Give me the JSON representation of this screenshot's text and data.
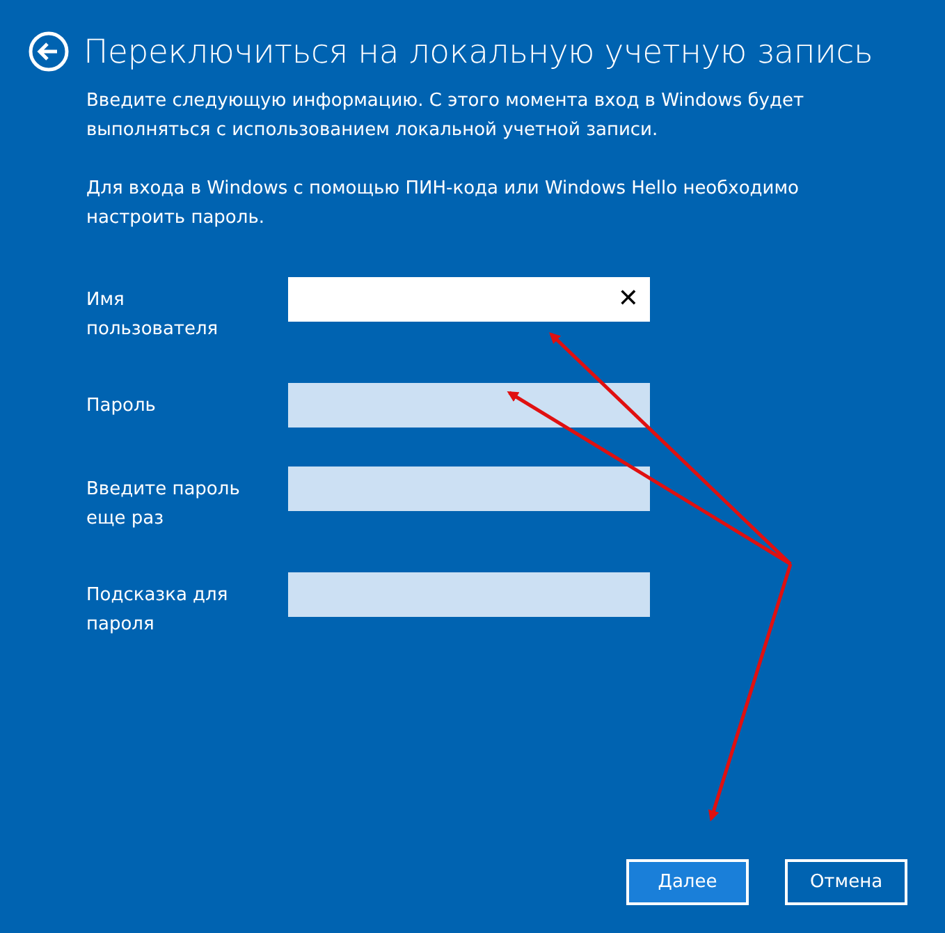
{
  "title": "Переключиться на локальную учетную запись",
  "paragraphs": [
    "Введите следующую информацию. С этого момента вход в Windows будет выполняться с использованием локальной учетной записи.",
    "Для входа в Windows с помощью ПИН-кода или Windows Hello необходимо настроить пароль."
  ],
  "fields": [
    {
      "label": "Имя пользователя",
      "focused": true,
      "clear_button": "✕"
    },
    {
      "label": "Пароль",
      "focused": false
    },
    {
      "label": "Введите пароль еще раз",
      "focused": false
    },
    {
      "label": "Подсказка для пароля",
      "focused": false
    }
  ],
  "buttons": [
    {
      "label": "Далее",
      "primary": true
    },
    {
      "label": "Отмена",
      "primary": false
    }
  ]
}
